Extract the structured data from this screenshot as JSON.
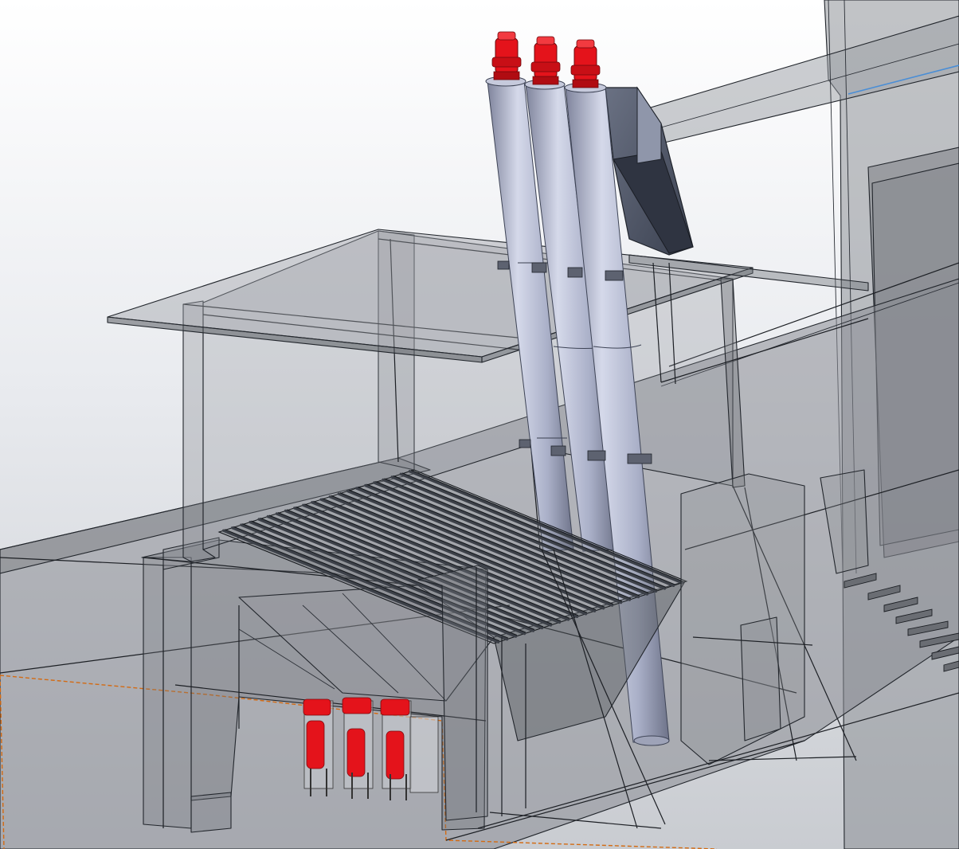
{
  "scene": {
    "background_top": "#ffffff",
    "background_bottom": "#9fa3a8",
    "glass_color": "#7d8086",
    "edge_color": "#1c1f24",
    "pipe_color": "#a9aec4",
    "motor_color": "#e4131b",
    "selection_color": "#d36a12",
    "highlight_line_color": "#4a8ed6",
    "screw_conveyor_count": 3,
    "pump_count": 3,
    "grate_bar_count": 22
  }
}
